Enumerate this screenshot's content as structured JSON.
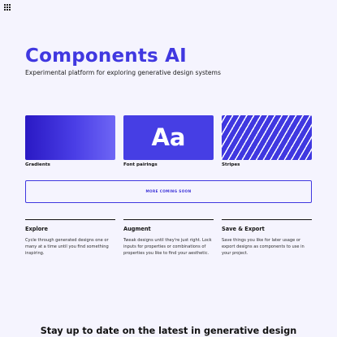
{
  "brand": {
    "logo_icon": "dot-grid-logo",
    "accent_color": "#4038e0"
  },
  "hero": {
    "title": "Components AI",
    "subtitle": "Experimental platform for exploring generative design systems"
  },
  "cards": [
    {
      "label": "Gradients"
    },
    {
      "label": "Font pairings",
      "glyph": "Aa"
    },
    {
      "label": "Stripes"
    }
  ],
  "more_button": {
    "label": "MORE COMING SOON"
  },
  "features": [
    {
      "title": "Explore",
      "description": "Cycle through generated designs one or many at a time until you find something inspiring."
    },
    {
      "title": "Augment",
      "description": "Tweak designs until they're just right. Lock inputs for properties or combinations of properties you like to find your aesthetic."
    },
    {
      "title": "Save & Export",
      "description": "Save things you like for later usage or export designs as components to use in your project."
    }
  ],
  "newsletter": {
    "heading": "Stay up to date on the latest in generative design"
  }
}
